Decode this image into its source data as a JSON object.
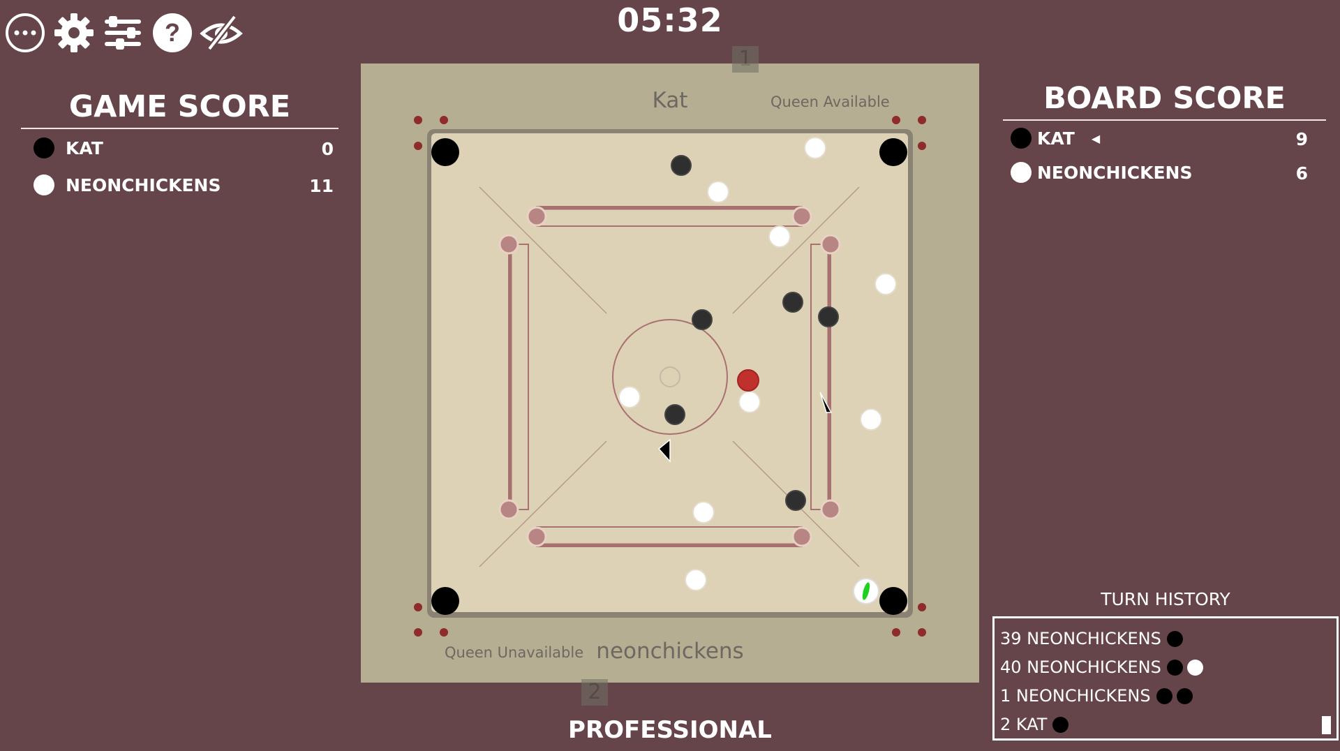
{
  "toolbar": {
    "icons": [
      "more-icon",
      "gear-icon",
      "sliders-icon",
      "help-icon",
      "hide-icon"
    ]
  },
  "timer": "05:32",
  "game_score": {
    "title": "GAME SCORE",
    "players": [
      {
        "name": "KAT",
        "color": "black",
        "score": "0"
      },
      {
        "name": "NEONCHICKENS",
        "color": "white",
        "score": "11"
      }
    ]
  },
  "board_score": {
    "title": "BOARD SCORE",
    "players": [
      {
        "name": "KAT",
        "color": "black",
        "score": "9",
        "active": true
      },
      {
        "name": "NEONCHICKENS",
        "color": "white",
        "score": "6",
        "active": false
      }
    ]
  },
  "board": {
    "top_tab": "1",
    "bottom_tab": "2",
    "top_player": "Kat",
    "top_queen_status": "Queen Available",
    "bottom_player": "neonchickens",
    "bottom_queen_status": "Queen Unavailable",
    "colors": {
      "frame": "#b6ae93",
      "playfield": "#ddd2b6",
      "line": "#a87070",
      "queen": "#c0312e"
    }
  },
  "mode": "PROFESSIONAL",
  "turn_history": {
    "title": "TURN HISTORY",
    "entries": [
      {
        "label": "39 NEONCHICKENS",
        "pieces": [
          "black"
        ]
      },
      {
        "label": "40 NEONCHICKENS",
        "pieces": [
          "black",
          "white"
        ]
      },
      {
        "label": "1 NEONCHICKENS",
        "pieces": [
          "black",
          "black"
        ]
      },
      {
        "label": "2 KAT",
        "pieces": [
          "black"
        ]
      }
    ]
  }
}
